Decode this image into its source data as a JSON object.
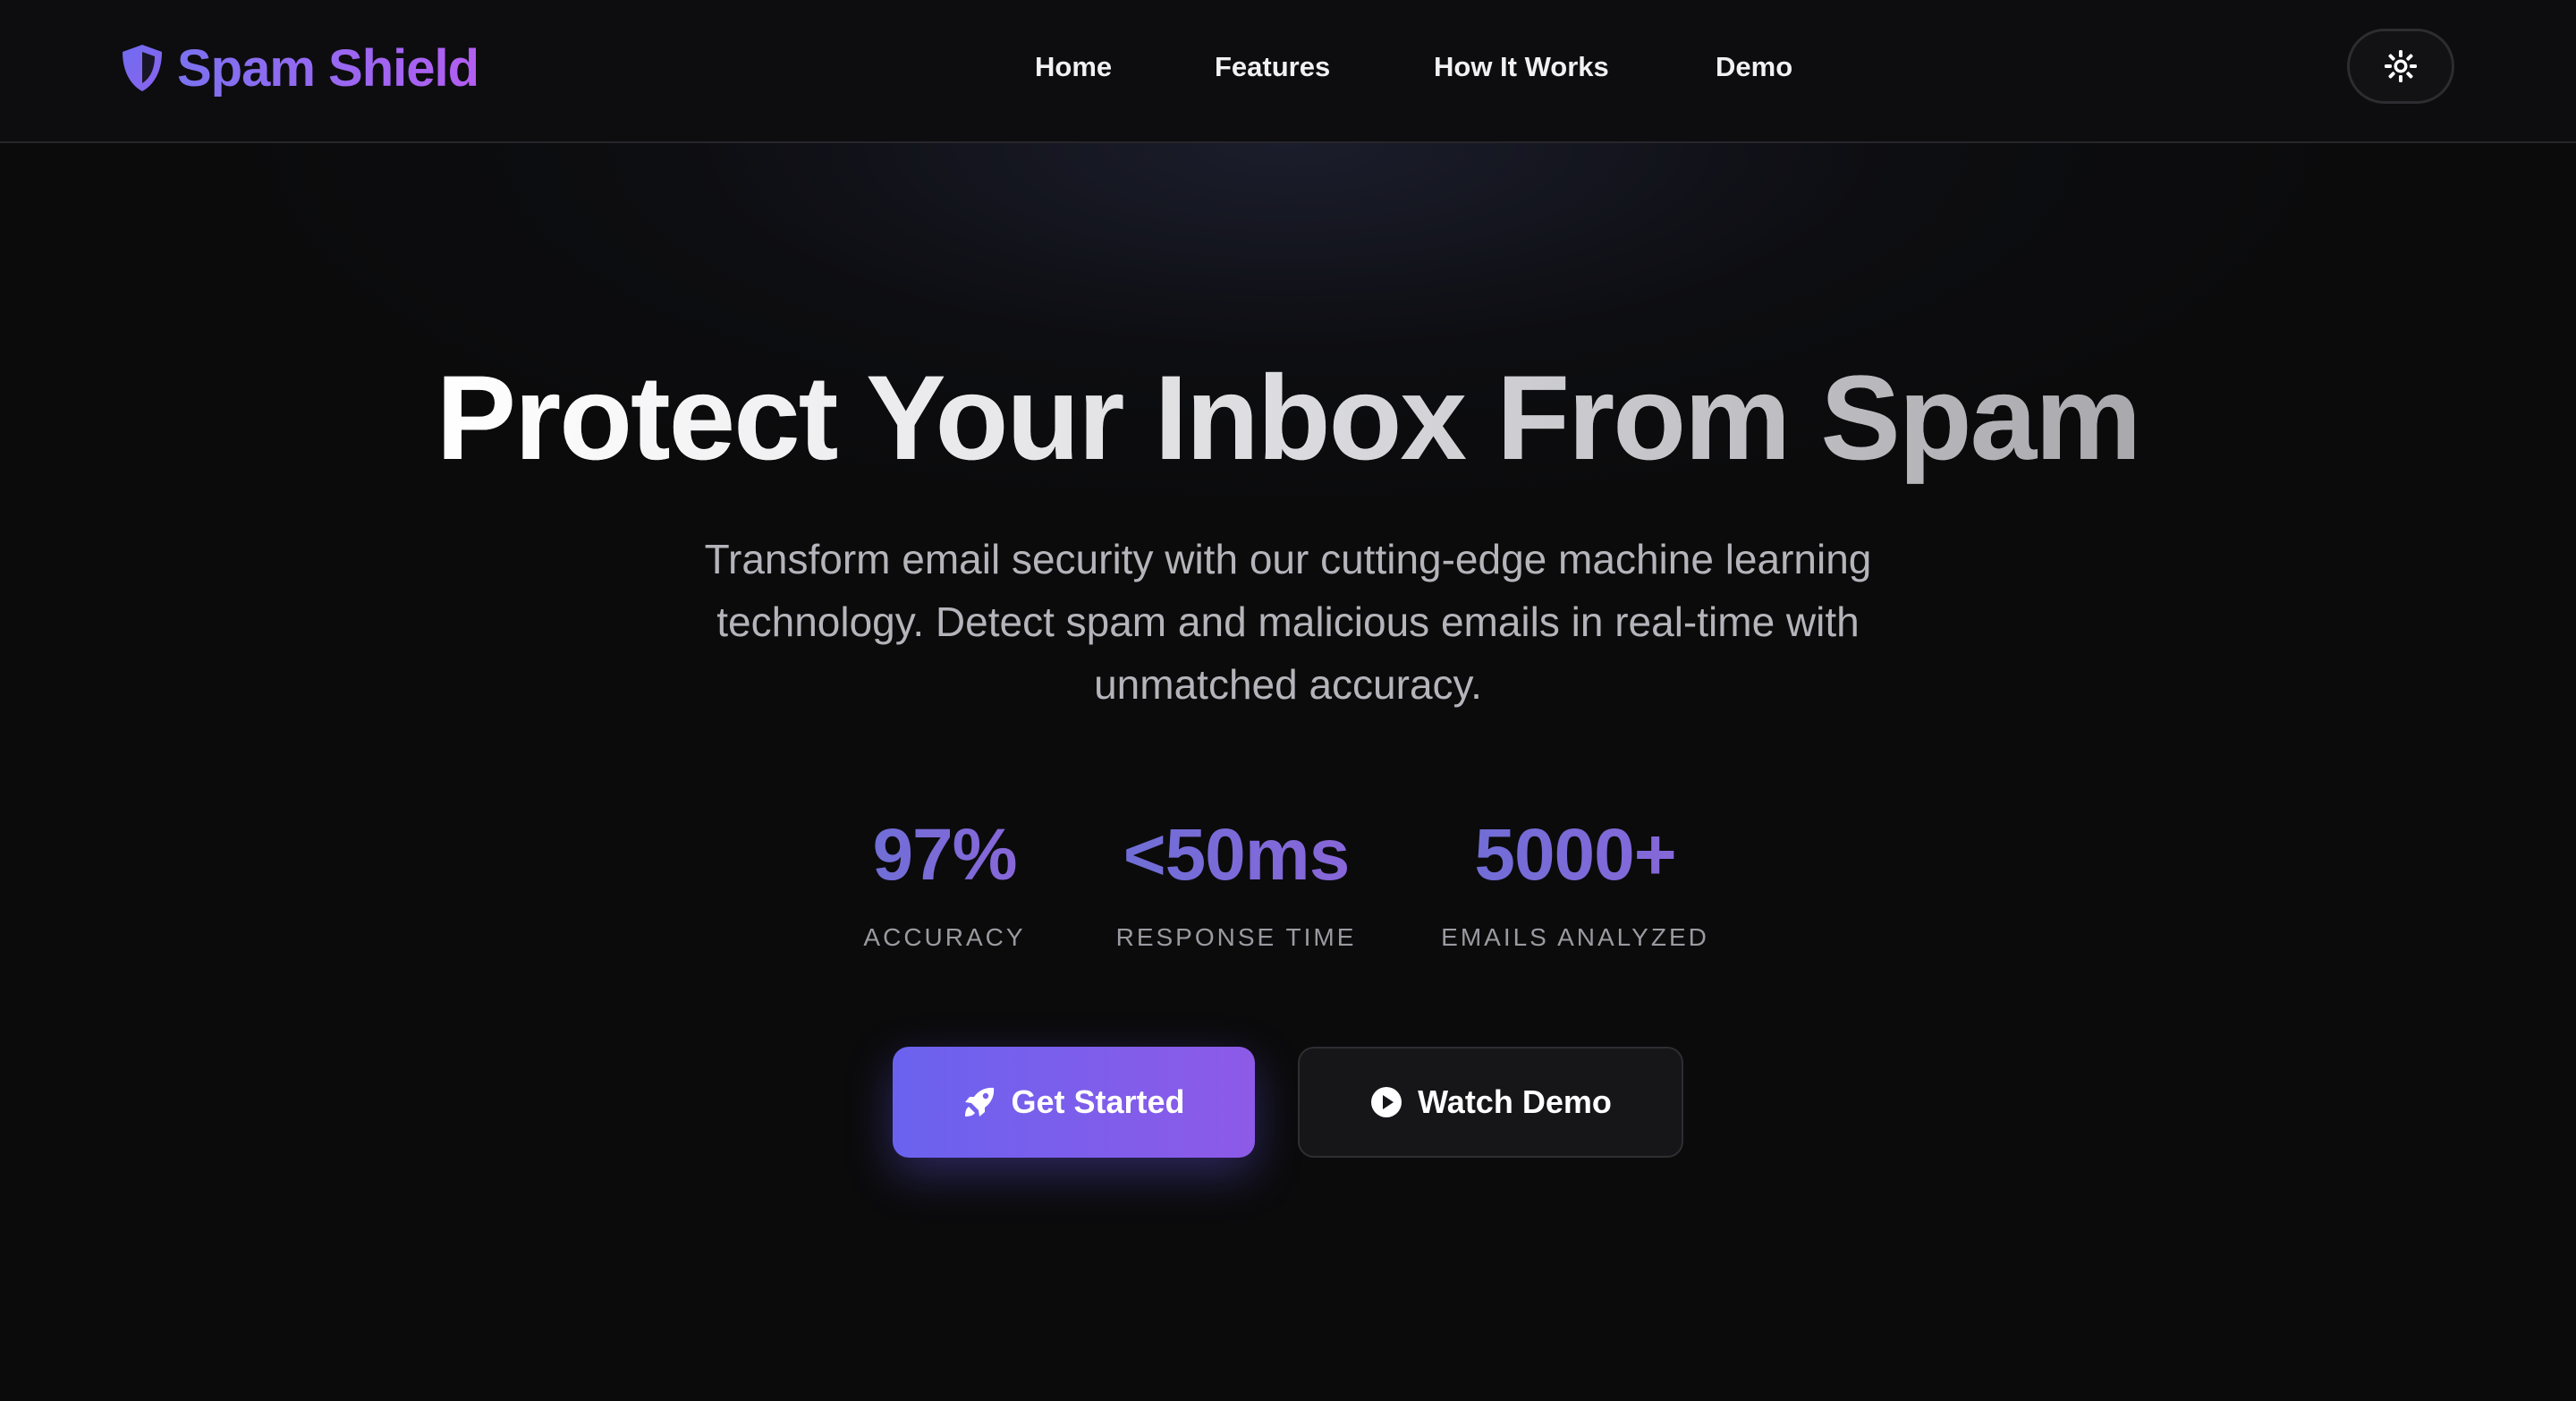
{
  "header": {
    "brand": {
      "name": "Spam Shield",
      "icon": "shield-icon"
    },
    "nav": [
      {
        "label": "Home"
      },
      {
        "label": "Features"
      },
      {
        "label": "How It Works"
      },
      {
        "label": "Demo"
      }
    ],
    "theme_toggle": {
      "icon": "sun-icon"
    }
  },
  "hero": {
    "title": "Protect Your Inbox From Spam",
    "subtitle": "Transform email security with our cutting-edge machine learning technology. Detect spam and malicious emails in real-time with unmatched accuracy.",
    "stats": [
      {
        "value": "97%",
        "label": "ACCURACY"
      },
      {
        "value": "<50ms",
        "label": "RESPONSE TIME"
      },
      {
        "value": "5000+",
        "label": "EMAILS ANALYZED"
      }
    ],
    "primary_button": {
      "label": "Get Started",
      "icon": "rocket-icon"
    },
    "secondary_button": {
      "label": "Watch Demo",
      "icon": "play-circle-icon"
    }
  },
  "colors": {
    "background": "#0b0b0c",
    "accent_start": "#6a62ef",
    "accent_end": "#8e5ae8",
    "brand_gradient_end": "#b35ef2"
  }
}
